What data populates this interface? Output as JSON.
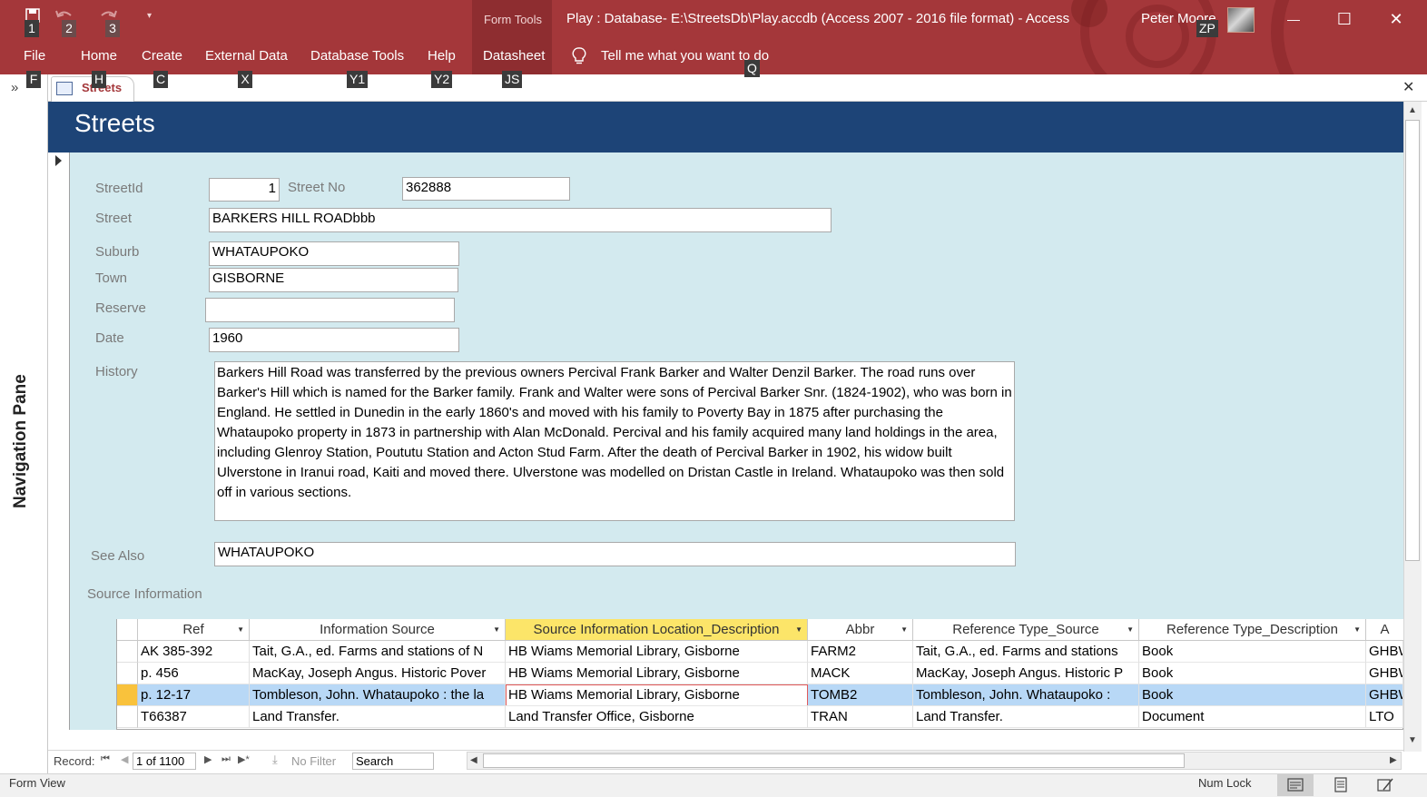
{
  "quick_access": {
    "keytips": [
      "1",
      "2",
      "3"
    ]
  },
  "title_bar": {
    "context_group": "Form Tools",
    "window_title": "Play : Database- E:\\StreetsDb\\Play.accdb (Access 2007 - 2016 file format)  -  Access",
    "user_name": "Peter Moore",
    "user_keytip": "ZP",
    "minimize": "—",
    "maximize": "☐",
    "close": "✕"
  },
  "ribbon": {
    "tabs": [
      {
        "label": "File",
        "keytip": "F"
      },
      {
        "label": "Home",
        "keytip": "H"
      },
      {
        "label": "Create",
        "keytip": "C"
      },
      {
        "label": "External Data",
        "keytip": "X"
      },
      {
        "label": "Database Tools",
        "keytip": "Y1"
      },
      {
        "label": "Help",
        "keytip": "Y2"
      },
      {
        "label": "Datasheet",
        "keytip": "JS"
      }
    ],
    "tell_me": "Tell me what you want to do",
    "tell_me_keytip": "Q"
  },
  "nav_pane": {
    "label": "Navigation Pane",
    "toggle": "»"
  },
  "document_tab": {
    "label": "Streets",
    "close": "✕"
  },
  "form": {
    "title": "Streets",
    "fields": {
      "street_id": {
        "label": "StreetId",
        "value": "1"
      },
      "street_no": {
        "label": "Street No",
        "value": "362888"
      },
      "street": {
        "label": "Street",
        "value": "BARKERS HILL ROADbbb"
      },
      "suburb": {
        "label": "Suburb",
        "value": "WHATAUPOKO"
      },
      "town": {
        "label": "Town",
        "value": "GISBORNE"
      },
      "reserve": {
        "label": "Reserve",
        "value": ""
      },
      "date": {
        "label": "Date",
        "value": "1960"
      },
      "history": {
        "label": "History",
        "value": "Barkers Hill Road was transferred by the previous owners Percival Frank Barker and Walter Denzil Barker.  The road runs over Barker's Hill which is named for the Barker family.  Frank and Walter were sons of Percival Barker Snr. (1824-1902), who was born in England.  He settled in Dunedin in the early 1860's and moved with his family to Poverty Bay in 1875 after purchasing the Whataupoko property in 1873 in partnership with Alan McDonald.  Percival and his family acquired many land holdings in the area, including Glenroy Station, Poututu Station and Acton Stud Farm.  After the death of Percival Barker in 1902, his widow built Ulverstone in Iranui road, Kaiti and moved there.  Ulverstone was modelled on Dristan Castle in Ireland.  Whataupoko was then sold off in various sections."
      },
      "see_also": {
        "label": "See Also",
        "value": "WHATAUPOKO"
      }
    },
    "source_label": "Source Information"
  },
  "subform": {
    "columns": [
      "Ref",
      "Information Source",
      "Source Information Location_Description",
      "Abbr",
      "Reference Type_Source",
      "Reference Type_Description",
      "A"
    ],
    "rows": [
      [
        "AK 385-392",
        "Tait, G.A., ed.  Farms and stations of N",
        "HB Wiams Memorial Library, Gisborne",
        "FARM2",
        "Tait, G.A., ed.  Farms and stations",
        "Book",
        "GHBW"
      ],
      [
        "p. 456",
        "MacKay, Joseph Angus.  Historic Pover",
        "HB Wiams Memorial Library, Gisborne",
        "MACK",
        "MacKay, Joseph Angus.  Historic P",
        "Book",
        "GHBW"
      ],
      [
        "p. 12-17",
        "Tombleson, John.  Whataupoko : the la",
        "HB Wiams Memorial Library, Gisborne",
        "TOMB2",
        "Tombleson, John.  Whataupoko :",
        "Book",
        "GHBW"
      ],
      [
        "T66387",
        "Land Transfer.",
        "Land Transfer Office, Gisborne",
        "TRAN",
        "Land Transfer.",
        "Document",
        "LTO"
      ]
    ],
    "selected_row": 2
  },
  "record_nav": {
    "label": "Record:",
    "first": "⏮",
    "prev": "◀",
    "position": "1 of 1100",
    "next": "▶",
    "last": "⏭",
    "new": "▶*",
    "filter": "No Filter",
    "search": "Search"
  },
  "status_bar": {
    "view": "Form View",
    "num_lock": "Num Lock"
  },
  "colors": {
    "ribbon": "#a4373a",
    "form_header": "#1d4477",
    "form_body": "#d3eaef",
    "active_header": "#fce569",
    "selected_row": "#b8d8f6",
    "record_selector": "#f9c23c"
  }
}
